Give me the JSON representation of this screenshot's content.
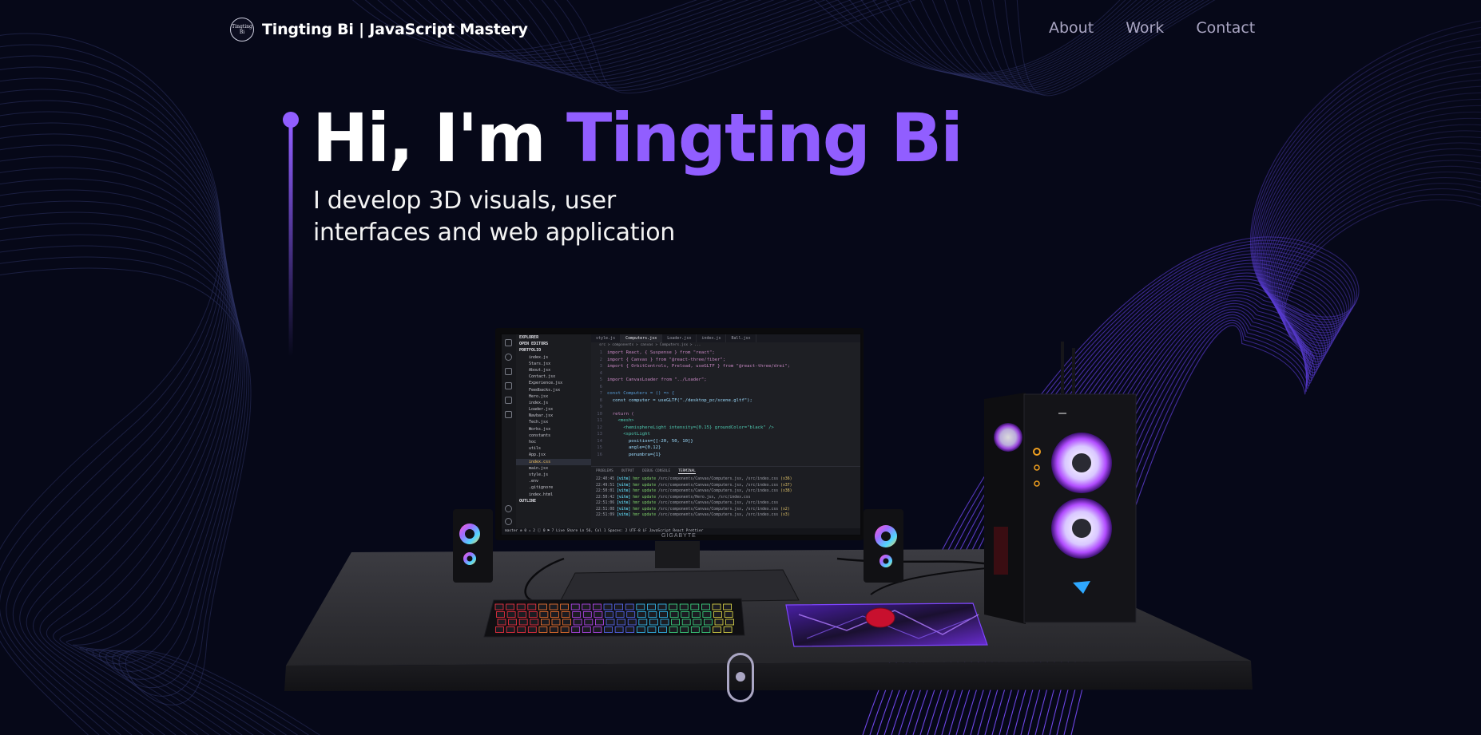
{
  "navbar": {
    "logo_text": "Tingting Bi",
    "brand": "Tingting Bi | JavaScript Mastery",
    "links": [
      {
        "label": "About"
      },
      {
        "label": "Work"
      },
      {
        "label": "Contact"
      }
    ]
  },
  "hero": {
    "greeting": "Hi, I'm ",
    "name": "Tingting Bi",
    "subtitle_line1": "I develop 3D visuals, user",
    "subtitle_line2": "interfaces and web application"
  },
  "colors": {
    "background": "#050816",
    "accent": "#915eff",
    "nav_text": "#aaa6c3"
  },
  "monitor": {
    "brand": "GIGABYTE",
    "tabs": [
      "style.js",
      "Computers.jsx",
      "Loader.jsx",
      "index.js",
      "Ball.jsx"
    ],
    "breadcrumb": "src > components > canvas > Computers.jsx > ...",
    "explorer": [
      {
        "label": "EXPLORER",
        "type": "sec"
      },
      {
        "label": "OPEN EDITORS",
        "type": "sec"
      },
      {
        "label": "PORTFOLIO",
        "type": "sec"
      },
      {
        "label": "index.js",
        "type": "file"
      },
      {
        "label": "Stars.jsx",
        "type": "file"
      },
      {
        "label": "About.jsx",
        "type": "file"
      },
      {
        "label": "Contact.jsx",
        "type": "file"
      },
      {
        "label": "Experience.jsx",
        "type": "file"
      },
      {
        "label": "Feedbacks.jsx",
        "type": "file"
      },
      {
        "label": "Hero.jsx",
        "type": "file"
      },
      {
        "label": "index.js",
        "type": "file"
      },
      {
        "label": "Loader.jsx",
        "type": "file"
      },
      {
        "label": "Navbar.jsx",
        "type": "file"
      },
      {
        "label": "Tech.jsx",
        "type": "file"
      },
      {
        "label": "Works.jsx",
        "type": "file"
      },
      {
        "label": "constants",
        "type": "file"
      },
      {
        "label": "hoc",
        "type": "file"
      },
      {
        "label": "utils",
        "type": "file"
      },
      {
        "label": "App.jsx",
        "type": "file"
      },
      {
        "label": "index.css",
        "type": "active"
      },
      {
        "label": "main.jsx",
        "type": "file"
      },
      {
        "label": "style.js",
        "type": "file"
      },
      {
        "label": ".env",
        "type": "file"
      },
      {
        "label": ".gitignore",
        "type": "file"
      },
      {
        "label": "index.html",
        "type": "file"
      },
      {
        "label": "OUTLINE",
        "type": "sec"
      }
    ],
    "code_lines": [
      "import React, { Suspense } from \"react\";",
      "import { Canvas } from \"@react-three/fiber\";",
      "import { OrbitControls, Preload, useGLTF } from \"@react-three/drei\";",
      "",
      "import CanvasLoader from \"../Loader\";",
      "",
      "const Computers = () => {",
      "  const computer = useGLTF(\"./desktop_pc/scene.gltf\");",
      "",
      "  return (",
      "    <mesh>",
      "      <hemisphereLight intensity={0.15} groundColor=\"black\" />",
      "      <spotLight",
      "        position={[-20, 50, 10]}",
      "        angle={0.12}",
      "        penumbra={1}"
    ],
    "panel_tabs": [
      "PROBLEMS",
      "OUTPUT",
      "DEBUG CONSOLE",
      "TERMINAL"
    ],
    "terminal_lines": [
      {
        "time": "22:40:45",
        "file": "/src/components/Canvas/Computers.jsx, /src/index.css",
        "count": "(x36)"
      },
      {
        "time": "22:49:51",
        "file": "/src/components/Canvas/Computers.jsx, /src/index.css",
        "count": "(x37)"
      },
      {
        "time": "22:50:01",
        "file": "/src/components/Canvas/Computers.jsx, /src/index.css",
        "count": "(x38)"
      },
      {
        "time": "22:50:42",
        "file": "/src/components/Hero.jsx, /src/index.css",
        "count": ""
      },
      {
        "time": "22:51:06",
        "file": "/src/components/Canvas/Computers.jsx, /src/index.css",
        "count": ""
      },
      {
        "time": "22:51:08",
        "file": "/src/components/Canvas/Computers.jsx, /src/index.css",
        "count": "(x2)"
      },
      {
        "time": "22:51:09",
        "file": "/src/components/Canvas/Computers.jsx, /src/index.css",
        "count": "(x3)"
      }
    ],
    "status_bar": "master  ⊗ 0 ⚠ 2  ⓘ 0 ⚑ 7  Live Share          Ln 56, Col 1   Spaces: 2   UTF-8   LF   JavaScript React   Prettier"
  },
  "scroll": {
    "label": "scroll-down"
  }
}
